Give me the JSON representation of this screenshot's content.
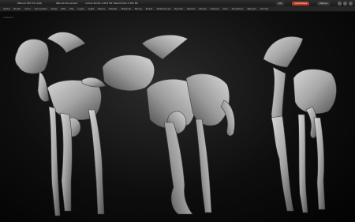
{
  "app": {
    "title_left": "ZBrush 4R7 P3 (x64)",
    "title_mid": "ZBrush Document",
    "title_info": "Active Points 1.653 Mil  Total Points 3.305 Mil",
    "badges": [
      "AC",
      "QuickSave",
      "Menus"
    ]
  },
  "menus": [
    "Alpha",
    "Brush",
    "Color",
    "Document",
    "Draw",
    "Edit",
    "File",
    "Layer",
    "Light",
    "Macro",
    "Marker",
    "Material",
    "Movie",
    "Picker",
    "Preferences",
    "Render",
    "Stencil",
    "Stroke",
    "Texture",
    "Tool",
    "Transform",
    "Zplugin",
    "Zscript"
  ],
  "viewport": {
    "label": "viewport",
    "status": ""
  },
  "icons": {
    "close": "close-icon",
    "minimize": "minimize-icon",
    "maximize": "maximize-icon"
  },
  "colors": {
    "accent": "#b83a23",
    "background": "#000000",
    "model_light": "#c9c9c9",
    "model_shadow": "#4a4a4a"
  }
}
